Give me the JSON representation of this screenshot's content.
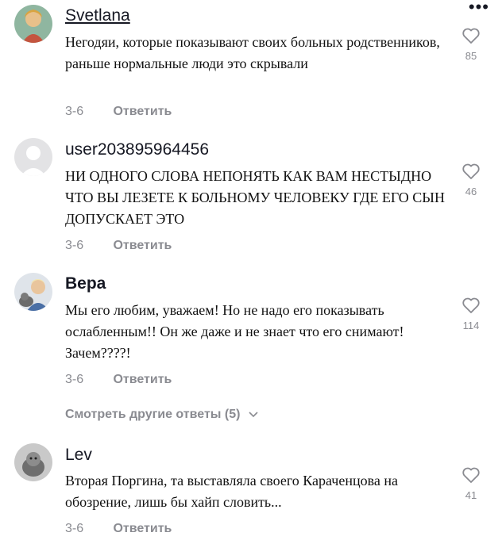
{
  "menu_icon": "more-horizontal-icon",
  "comments": [
    {
      "username": "Svetlana",
      "text": "Негодяи, которые показывают своих больных родственников, раньше нормальные люди это скрывали",
      "date": "3-6",
      "reply_label": "Ответить",
      "likes": "85",
      "like_icon": "heart-outline-icon"
    },
    {
      "username": "user203895964456",
      "text": "НИ ОДНОГО СЛОВА НЕПОНЯТЬ КАК ВАМ НЕСТЫДНО ЧТО ВЫ ЛЕЗЕТЕ К БОЛЬНОМУ ЧЕЛОВЕКУ ГДЕ ЕГО СЫН ДОПУСКАЕТ ЭТО",
      "date": "3-6",
      "reply_label": "Ответить",
      "likes": "46",
      "like_icon": "heart-outline-icon"
    },
    {
      "username": "Вера",
      "text": "Мы его любим, уважаем! Но не надо его показывать ослабленным!! Он же даже и не знает что его снимают! Зачем????!",
      "date": "3-6",
      "reply_label": "Ответить",
      "likes": "114",
      "like_icon": "heart-outline-icon"
    },
    {
      "username": "Lev",
      "text": "Вторая Поргина, та выставляла своего Караченцова на обозрение, лишь бы хайп словить...",
      "date": "3-6",
      "reply_label": "Ответить",
      "likes": "41",
      "like_icon": "heart-outline-icon"
    }
  ],
  "view_more": {
    "label": "Смотреть другие ответы",
    "count": "(5)",
    "icon": "chevron-down-icon"
  },
  "colors": {
    "text": "#161823",
    "muted": "#8a8b91",
    "background": "#ffffff"
  }
}
